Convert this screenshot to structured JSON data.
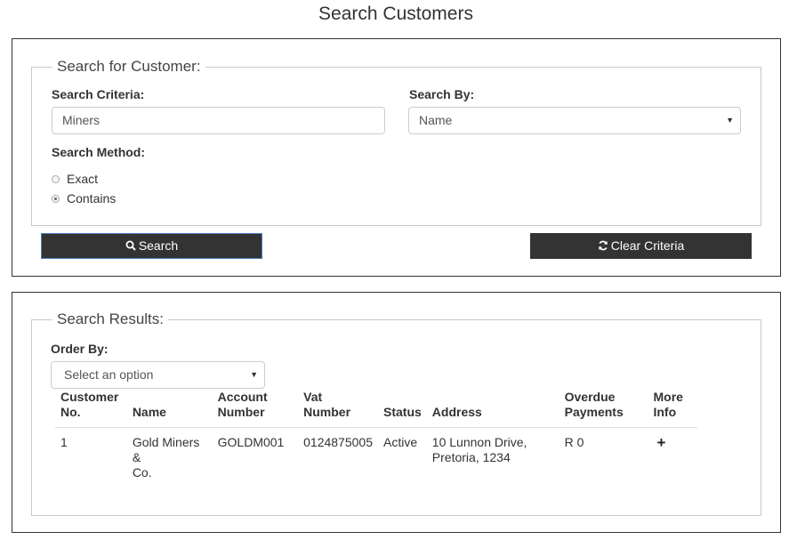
{
  "page": {
    "title": "Search Customers"
  },
  "search": {
    "legend": "Search for Customer:",
    "criteria_label": "Search Criteria:",
    "criteria_value": "Miners",
    "search_by_label": "Search By:",
    "search_by_value": "Name",
    "method_label": "Search Method:",
    "method_options": [
      {
        "label": "Exact",
        "checked": false
      },
      {
        "label": "Contains",
        "checked": true
      }
    ],
    "search_button": "Search",
    "clear_button": "Clear Criteria"
  },
  "results": {
    "legend": "Search Results:",
    "order_by_label": "Order By:",
    "order_by_value": "Select an option",
    "columns": [
      [
        "Customer",
        "No."
      ],
      [
        "",
        "Name"
      ],
      [
        "Account",
        "Number"
      ],
      [
        "Vat",
        "Number"
      ],
      [
        "",
        "Status"
      ],
      [
        "",
        "Address"
      ],
      [
        "Overdue",
        "Payments"
      ],
      [
        "More",
        "Info"
      ]
    ],
    "rows": [
      {
        "customer_no": "1",
        "name": [
          "Gold Miners &",
          "Co."
        ],
        "account_number": "GOLDM001",
        "vat_number": "0124875005",
        "status": "Active",
        "address": [
          "10 Lunnon Drive,",
          "Pretoria, 1234"
        ],
        "overdue": "R 0",
        "more_info": "+"
      }
    ]
  }
}
